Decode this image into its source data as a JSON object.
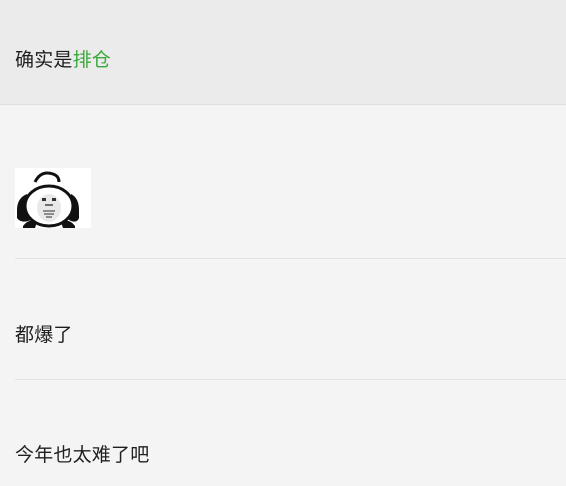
{
  "messages": [
    {
      "prefix": "确实是",
      "highlight": "排仓",
      "highlight_color": "#3aa83a"
    },
    {
      "sticker": "panda-meme-sticker"
    },
    {
      "text": "都爆了"
    },
    {
      "text": "今年也太难了吧"
    }
  ],
  "colors": {
    "background": "#f4f4f4",
    "selected_background": "#ebebeb",
    "text": "#1f1f1f",
    "divider": "#e2e2e2"
  }
}
